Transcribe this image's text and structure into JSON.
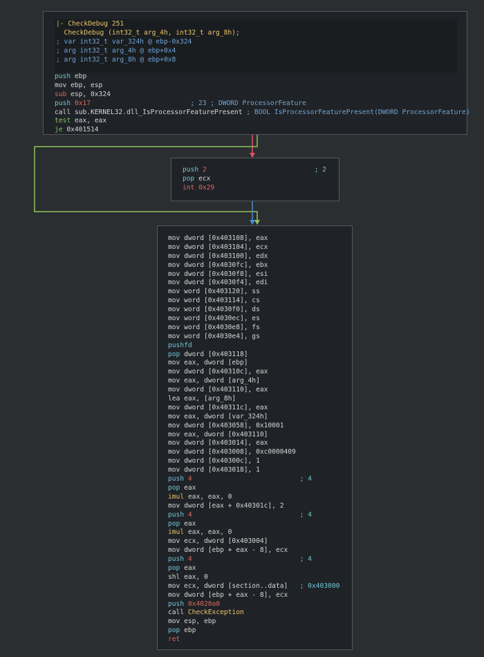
{
  "colors": {
    "background": "#2b2e31",
    "node_bg": "#1f2226",
    "node_border": "#54585c",
    "edge_true": "#8fc35a",
    "edge_false": "#e05561",
    "edge_uncond": "#4b8fd0"
  },
  "node1": {
    "header": [
      {
        "t": "|- CheckDebug 251",
        "c": "m-yellow"
      },
      {
        "t": "  CheckDebug (int32_t arg_4h, int32_t arg_8h);",
        "c": "m-yellow"
      },
      {
        "t": "; var int32_t var_324h @ ebp-0x324",
        "c": "c-blue"
      },
      {
        "t": "; arg int32_t arg_4h @ ebp+0x4",
        "c": "c-blue"
      },
      {
        "t": "; arg int32_t arg_8h @ ebp+0x8",
        "c": "c-blue"
      }
    ],
    "lines": [
      {
        "m": "push",
        "mc": "m-cyan",
        "o": "ebp"
      },
      {
        "m": "mov",
        "mc": "plain",
        "o": "ebp, esp"
      },
      {
        "m": "sub",
        "mc": "m-red",
        "o": "esp, 0x324"
      },
      {
        "m": "push",
        "mc": "m-cyan",
        "o": "0x17",
        "oc": "n-red",
        "cm": "; 23 ; DWORD ProcessorFeature",
        "cc": "c-blue"
      },
      {
        "m": "call",
        "mc": "plain",
        "o": "sub.KERNEL32.dll_IsProcessorFeaturePresent",
        "cm": "; BOOL IsProcessorFeaturePresent(DWORD ProcessorFeature)",
        "cc": "c-blue"
      },
      {
        "m": "test",
        "mc": "m-green",
        "o": "eax, eax"
      },
      {
        "m": "je",
        "mc": "m-green",
        "o": "0x401514"
      }
    ]
  },
  "node2": {
    "lines": [
      {
        "m": "push",
        "mc": "m-cyan",
        "o": "2",
        "oc": "n-red",
        "cm": "; 2",
        "cc": "c-cyan"
      },
      {
        "m": "pop",
        "mc": "m-cyan",
        "o": "ecx"
      },
      {
        "m": "int",
        "mc": "m-red",
        "o": "0x29",
        "oc": "n-red"
      }
    ]
  },
  "node3": {
    "lines": [
      {
        "m": "mov",
        "mc": "plain",
        "o": "dword [0x403108], eax"
      },
      {
        "m": "mov",
        "mc": "plain",
        "o": "dword [0x403104], ecx"
      },
      {
        "m": "mov",
        "mc": "plain",
        "o": "dword [0x403100], edx"
      },
      {
        "m": "mov",
        "mc": "plain",
        "o": "dword [0x4030fc], ebx"
      },
      {
        "m": "mov",
        "mc": "plain",
        "o": "dword [0x4030f8], esi"
      },
      {
        "m": "mov",
        "mc": "plain",
        "o": "dword [0x4030f4], edi"
      },
      {
        "m": "mov",
        "mc": "plain",
        "o": "word [0x403120], ss"
      },
      {
        "m": "mov",
        "mc": "plain",
        "o": "word [0x403114], cs"
      },
      {
        "m": "mov",
        "mc": "plain",
        "o": "word [0x4030f0], ds"
      },
      {
        "m": "mov",
        "mc": "plain",
        "o": "word [0x4030ec], es"
      },
      {
        "m": "mov",
        "mc": "plain",
        "o": "word [0x4030e8], fs"
      },
      {
        "m": "mov",
        "mc": "plain",
        "o": "word [0x4030e4], gs"
      },
      {
        "m": "pushfd",
        "mc": "m-cyan",
        "o": ""
      },
      {
        "m": "pop",
        "mc": "m-cyan",
        "o": "dword [0x403118]"
      },
      {
        "m": "mov",
        "mc": "plain",
        "o": "eax, dword [ebp]"
      },
      {
        "m": "mov",
        "mc": "plain",
        "o": "dword [0x40310c], eax"
      },
      {
        "m": "mov",
        "mc": "plain",
        "o": "eax, dword [arg_4h]"
      },
      {
        "m": "mov",
        "mc": "plain",
        "o": "dword [0x403110], eax"
      },
      {
        "m": "lea",
        "mc": "plain",
        "o": "eax, [arg_8h]"
      },
      {
        "m": "mov",
        "mc": "plain",
        "o": "dword [0x40311c], eax"
      },
      {
        "m": "mov",
        "mc": "plain",
        "o": "eax, dword [var_324h]"
      },
      {
        "m": "mov",
        "mc": "plain",
        "o": "dword [0x403058], 0x10001"
      },
      {
        "m": "mov",
        "mc": "plain",
        "o": "eax, dword [0x403110]"
      },
      {
        "m": "mov",
        "mc": "plain",
        "o": "dword [0x403014], eax"
      },
      {
        "m": "mov",
        "mc": "plain",
        "o": "dword [0x403008], 0xc0000409"
      },
      {
        "m": "mov",
        "mc": "plain",
        "o": "dword [0x40300c], 1"
      },
      {
        "m": "mov",
        "mc": "plain",
        "o": "dword [0x403018], 1"
      },
      {
        "m": "push",
        "mc": "m-cyan",
        "o": "4",
        "oc": "n-red",
        "cm": "; 4",
        "cc": "c-cyan"
      },
      {
        "m": "pop",
        "mc": "m-cyan",
        "o": "eax"
      },
      {
        "m": "imul",
        "mc": "m-yellow",
        "o": "eax, eax, 0"
      },
      {
        "m": "mov",
        "mc": "plain",
        "o": "dword [eax + 0x40301c], 2"
      },
      {
        "m": "push",
        "mc": "m-cyan",
        "o": "4",
        "oc": "n-red",
        "cm": "; 4",
        "cc": "c-cyan"
      },
      {
        "m": "pop",
        "mc": "m-cyan",
        "o": "eax"
      },
      {
        "m": "imul",
        "mc": "m-yellow",
        "o": "eax, eax, 0"
      },
      {
        "m": "mov",
        "mc": "plain",
        "o": "ecx, dword [0x403004]"
      },
      {
        "m": "mov",
        "mc": "plain",
        "o": "dword [ebp + eax - 8], ecx"
      },
      {
        "m": "push",
        "mc": "m-cyan",
        "o": "4",
        "oc": "n-red",
        "cm": "; 4",
        "cc": "c-cyan"
      },
      {
        "m": "pop",
        "mc": "m-cyan",
        "o": "eax"
      },
      {
        "m": "shl",
        "mc": "plain",
        "o": "eax, 0"
      },
      {
        "m": "mov",
        "mc": "plain",
        "o": "ecx, dword [section..data]",
        "cm": "; 0x403000",
        "cc": "c-cyan"
      },
      {
        "m": "mov",
        "mc": "plain",
        "o": "dword [ebp + eax - 8], ecx"
      },
      {
        "m": "push",
        "mc": "m-cyan",
        "o": "0x4020a0",
        "oc": "n-red"
      },
      {
        "m": "call",
        "mc": "plain",
        "o": "CheckException",
        "oc": "m-yellow"
      },
      {
        "m": "mov",
        "mc": "plain",
        "o": "esp, ebp"
      },
      {
        "m": "pop",
        "mc": "m-cyan",
        "o": "ebp"
      },
      {
        "m": "ret",
        "mc": "m-red",
        "o": ""
      }
    ]
  }
}
